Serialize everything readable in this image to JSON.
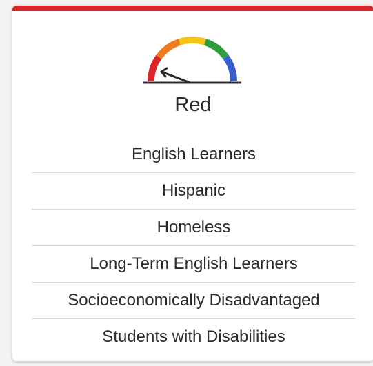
{
  "card": {
    "accent_color": "#d9262b",
    "status": "Red",
    "gauge": {
      "icon": "gauge-icon",
      "segment_colors": [
        "#d9262b",
        "#f07a1c",
        "#f5c518",
        "#2e9e41",
        "#3a5fcd"
      ],
      "needle_color": "#2b2b2b"
    },
    "student_groups": [
      "English Learners",
      "Hispanic",
      "Homeless",
      "Long-Term English Learners",
      "Socioeconomically Disadvantaged",
      "Students with Disabilities"
    ]
  }
}
